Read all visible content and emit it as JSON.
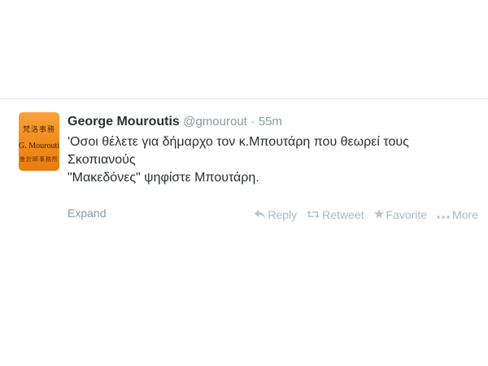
{
  "tweet": {
    "avatar": {
      "top_text": "梵洛事務",
      "name_text": "G. Mouroutis",
      "bottom_text": "會計師事務所"
    },
    "fullname": "George Mouroutis",
    "username": "@gmourout",
    "separator": "·",
    "time": "55m",
    "text_line1": "'Οσοι θέλετε για δήμαρχο τον κ.Μπουτάρη που θεωρεί τους Σκοπιανούς",
    "text_line2": "\"Μακεδόνες\" ψηφίστε Μπουτάρη.",
    "expand_label": "Expand",
    "actions": {
      "reply": {
        "icon": "reply-icon",
        "label": "Reply"
      },
      "retweet": {
        "icon": "retweet-icon",
        "label": "Retweet"
      },
      "favorite": {
        "icon": "star-icon",
        "label": "Favorite"
      },
      "more": {
        "icon": "more-icon",
        "label": "More"
      }
    }
  },
  "colors": {
    "text": "#292f33",
    "muted": "#8899a6",
    "action": "#aab8c2",
    "avatar_bg": "#f08a1c"
  }
}
